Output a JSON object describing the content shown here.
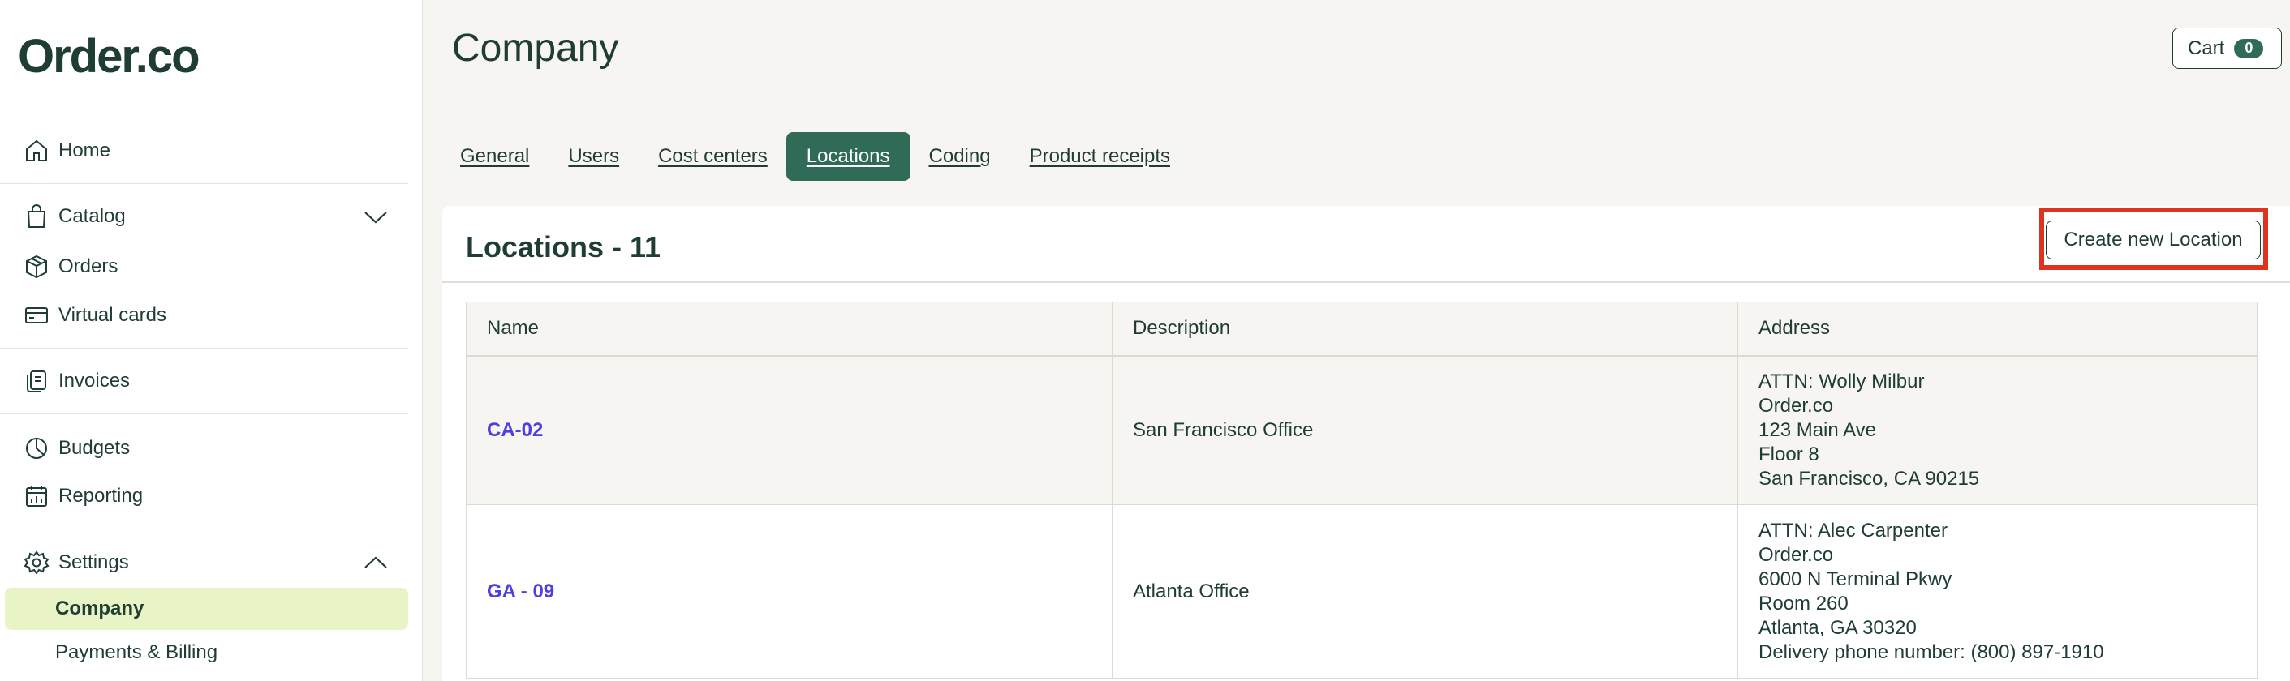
{
  "brand": {
    "logo": "Order.co"
  },
  "sidebar": {
    "items": [
      {
        "label": "Home",
        "icon": "home-icon"
      },
      {
        "label": "Catalog",
        "icon": "shopping-bag-icon"
      },
      {
        "label": "Orders",
        "icon": "box-icon"
      },
      {
        "label": "Virtual cards",
        "icon": "credit-card-icon"
      },
      {
        "label": "Invoices",
        "icon": "invoice-icon"
      },
      {
        "label": "Budgets",
        "icon": "pie-chart-icon"
      },
      {
        "label": "Reporting",
        "icon": "calendar-chart-icon"
      },
      {
        "label": "Settings",
        "icon": "gear-icon"
      }
    ],
    "settings_sub": [
      {
        "label": "Company",
        "active": true
      },
      {
        "label": "Payments & Billing",
        "active": false
      }
    ]
  },
  "header": {
    "title": "Company",
    "cart_label": "Cart",
    "cart_count": "0"
  },
  "tabs": [
    {
      "label": "General"
    },
    {
      "label": "Users"
    },
    {
      "label": "Cost centers"
    },
    {
      "label": "Locations",
      "active": true
    },
    {
      "label": "Coding"
    },
    {
      "label": "Product receipts"
    }
  ],
  "locations": {
    "title": "Locations - 11",
    "create_button": "Create new Location",
    "columns": [
      "Name",
      "Description",
      "Address"
    ],
    "rows": [
      {
        "name": "CA-02",
        "description": "San Francisco Office",
        "address": [
          "ATTN: Wolly Milbur",
          "Order.co",
          "123 Main Ave",
          "Floor 8",
          "San Francisco, CA 90215"
        ]
      },
      {
        "name": "GA - 09",
        "description": "Atlanta Office",
        "address": [
          "ATTN: Alec Carpenter",
          "Order.co",
          "6000 N Terminal Pkwy",
          "Room 260",
          "Atlanta, GA 30320",
          "Delivery phone number: (800) 897-1910"
        ]
      }
    ]
  },
  "colors": {
    "primary": "#2f6b57",
    "text": "#1f3d33",
    "link": "#4f3fe0",
    "active_sub_bg": "#e8f3c6",
    "highlight": "#e0331f"
  }
}
